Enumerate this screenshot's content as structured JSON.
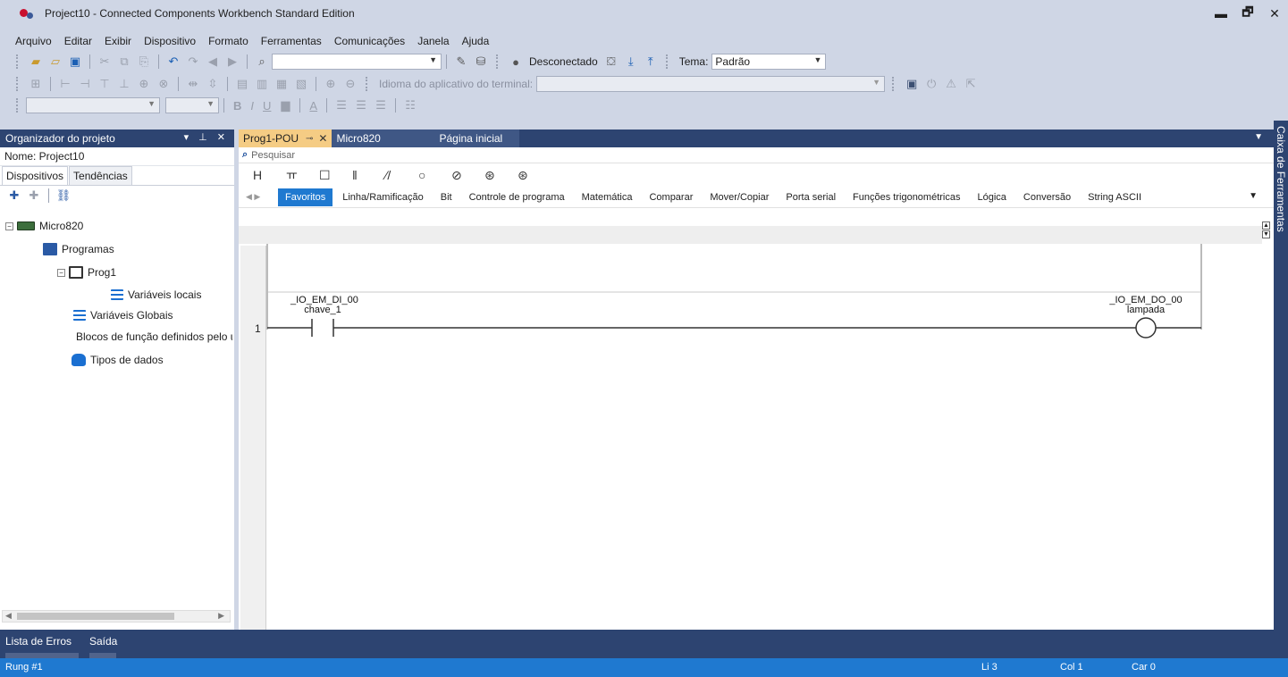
{
  "window": {
    "title": "Project10 - Connected Components Workbench Standard Edition",
    "controls": {
      "minimize": "▬",
      "restore": "🗗",
      "close": "✕"
    }
  },
  "menu": [
    "Arquivo",
    "Editar",
    "Exibir",
    "Dispositivo",
    "Formato",
    "Ferramentas",
    "Comunicações",
    "Janela",
    "Ajuda"
  ],
  "toolbar1": {
    "status": "Desconectado",
    "theme_label": "Tema:",
    "theme_value": "Padrão"
  },
  "toolbar2": {
    "terminal_language_label": "Idioma do aplicativo do terminal:"
  },
  "toolbar3": {
    "bold": "B",
    "italic": "I",
    "underline": "U",
    "font_color": "A"
  },
  "project_panel": {
    "title": "Organizador do projeto",
    "header_controls": "▾ ⊥ ✕",
    "name_label": "Nome: Project10",
    "tabs": [
      "Dispositivos",
      "Tendências"
    ],
    "tree": {
      "device": "Micro820",
      "programs": "Programas",
      "prog": "Prog1",
      "local_vars": "Variáveis locais",
      "global_vars": "Variáveis Globais",
      "function_blocks": "Blocos de função definidos pelo usuário",
      "data_types": "Tipos de dados"
    }
  },
  "doc_tabs": [
    {
      "label": "Prog1-POU",
      "active": true
    },
    {
      "label": "Micro820",
      "active": false
    },
    {
      "label": "Página inicial",
      "active": false
    }
  ],
  "editor": {
    "search_placeholder": "Pesquisar",
    "element_icons": [
      "H",
      "ㅠ",
      "☐",
      "‖",
      "⁄/",
      "○",
      "⊘",
      "⊛",
      "⊛"
    ],
    "categories": [
      "Favoritos",
      "Linha/Ramificação",
      "Bit",
      "Controle de programa",
      "Matemática",
      "Comparar",
      "Mover/Copiar",
      "Porta serial",
      "Funções trigonométricas",
      "Lógica",
      "Conversão",
      "String ASCII"
    ],
    "active_category": "Favoritos",
    "rung": {
      "number": "1",
      "contact_io": "_IO_EM_DI_00",
      "contact_var": "chave_1",
      "coil_io": "_IO_EM_DO_00",
      "coil_var": "lampada"
    }
  },
  "toolbox_label": "Caixa de Ferramentas",
  "bottom_tabs": [
    "Lista de Erros",
    "Saída"
  ],
  "statusbar": {
    "left": "Rung #1",
    "line": "Li 3",
    "col": "Col 1",
    "car": "Car 0"
  },
  "colors": {
    "chrome": "#cfd6e5",
    "panel_header": "#2d4471",
    "active_tab": "#f5cc84",
    "accent": "#1f79d0"
  }
}
